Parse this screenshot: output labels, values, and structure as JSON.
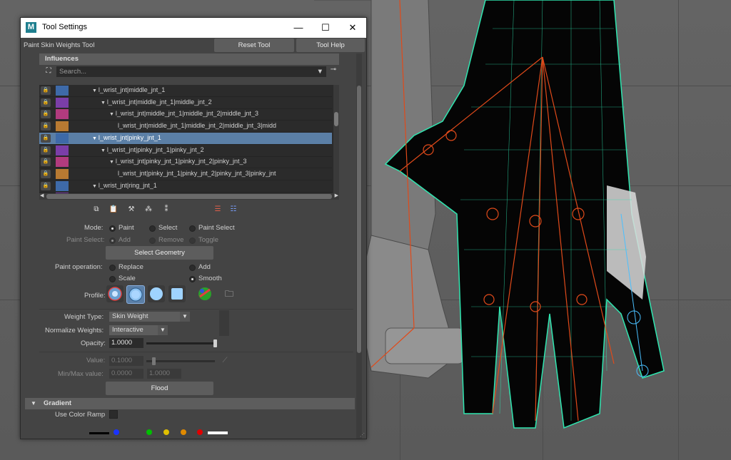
{
  "window": {
    "title": "Tool Settings",
    "logo_letter": "M",
    "minimize": "—",
    "maximize": "☐",
    "close": "✕"
  },
  "tool": {
    "name": "Paint Skin Weights Tool",
    "reset_label": "Reset Tool",
    "help_label": "Tool Help"
  },
  "influences": {
    "header": "Influences",
    "search_placeholder": "Search...",
    "rows": [
      {
        "name": "l_wrist_jnt|middle_jnt_1",
        "color": "#3e6aa8",
        "indent": 1,
        "arrow": "▼"
      },
      {
        "name": "l_wrist_jnt|middle_jnt_1|middle_jnt_2",
        "color": "#7b3ea8",
        "indent": 2,
        "arrow": "▼"
      },
      {
        "name": "l_wrist_jnt|middle_jnt_1|middle_jnt_2|middle_jnt_3",
        "color": "#b23b7e",
        "indent": 3,
        "arrow": "▼"
      },
      {
        "name": "l_wrist_jnt|middle_jnt_1|middle_jnt_2|middle_jnt_3|midd",
        "color": "#b87a32",
        "indent": 4,
        "arrow": ""
      },
      {
        "name": "l_wrist_jnt|pinky_jnt_1",
        "color": "#3e6aa8",
        "indent": 1,
        "arrow": "▼",
        "selected": true
      },
      {
        "name": "l_wrist_jnt|pinky_jnt_1|pinky_jnt_2",
        "color": "#7b3ea8",
        "indent": 2,
        "arrow": "▼"
      },
      {
        "name": "l_wrist_jnt|pinky_jnt_1|pinky_jnt_2|pinky_jnt_3",
        "color": "#b23b7e",
        "indent": 3,
        "arrow": "▼"
      },
      {
        "name": "l_wrist_jnt|pinky_jnt_1|pinky_jnt_2|pinky_jnt_3|pinky_jnt",
        "color": "#b87a32",
        "indent": 4,
        "arrow": ""
      },
      {
        "name": "l_wrist_jnt|ring_jnt_1",
        "color": "#3e6aa8",
        "indent": 1,
        "arrow": "▼"
      },
      {
        "name": "",
        "color": "#7b3ea8",
        "indent": 2,
        "arrow": ""
      }
    ]
  },
  "mode": {
    "label": "Mode:",
    "options": [
      "Paint",
      "Select",
      "Paint Select"
    ],
    "selected": "Paint"
  },
  "paint_select": {
    "label": "Paint Select:",
    "options": [
      "Add",
      "Remove",
      "Toggle"
    ]
  },
  "select_geometry_label": "Select Geometry",
  "paint_operation": {
    "label": "Paint operation:",
    "options": [
      "Replace",
      "Add",
      "Scale",
      "Smooth"
    ],
    "selected": "Smooth"
  },
  "profile_label": "Profile:",
  "weight_type": {
    "label": "Weight Type:",
    "value": "Skin Weight"
  },
  "normalize": {
    "label": "Normalize Weights:",
    "value": "Interactive"
  },
  "opacity": {
    "label": "Opacity:",
    "value": "1.0000",
    "level": 1.0
  },
  "value_field": {
    "label": "Value:",
    "value": "0.1000",
    "level": 0.1
  },
  "minmax": {
    "label": "Min/Max value:",
    "min": "0.0000",
    "max": "1.0000"
  },
  "flood_label": "Flood",
  "gradient": {
    "header": "Gradient",
    "color_ramp_label": "Use Color Ramp",
    "ramp_colors": [
      "#1a33ff",
      "#00c000",
      "#e0c000",
      "#e08a00",
      "#e00000"
    ]
  }
}
